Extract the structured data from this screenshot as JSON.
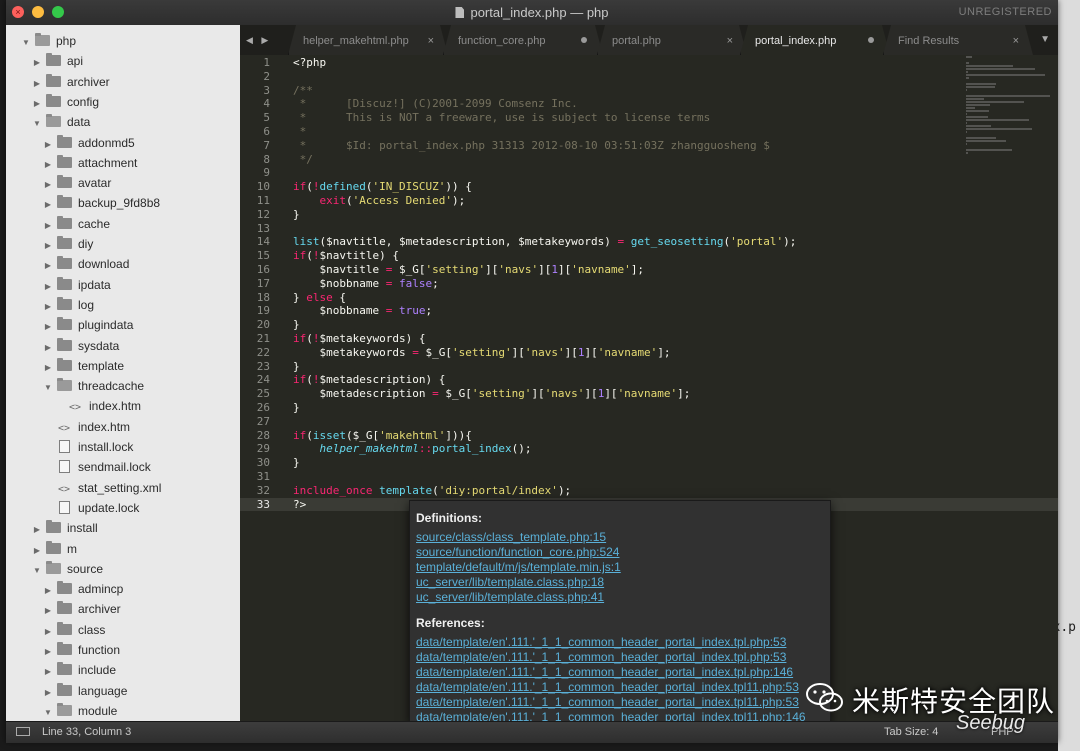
{
  "window": {
    "title": "portal_index.php — php",
    "unregistered": "UNREGISTERED"
  },
  "sidebar": {
    "items": [
      {
        "label": "php",
        "depth": 0,
        "type": "folder",
        "open": true
      },
      {
        "label": "api",
        "depth": 1,
        "type": "folder",
        "open": false
      },
      {
        "label": "archiver",
        "depth": 1,
        "type": "folder",
        "open": false
      },
      {
        "label": "config",
        "depth": 1,
        "type": "folder",
        "open": false
      },
      {
        "label": "data",
        "depth": 1,
        "type": "folder",
        "open": true
      },
      {
        "label": "addonmd5",
        "depth": 2,
        "type": "folder",
        "open": false
      },
      {
        "label": "attachment",
        "depth": 2,
        "type": "folder",
        "open": false
      },
      {
        "label": "avatar",
        "depth": 2,
        "type": "folder",
        "open": false
      },
      {
        "label": "backup_9fd8b8",
        "depth": 2,
        "type": "folder",
        "open": false
      },
      {
        "label": "cache",
        "depth": 2,
        "type": "folder",
        "open": false
      },
      {
        "label": "diy",
        "depth": 2,
        "type": "folder",
        "open": false
      },
      {
        "label": "download",
        "depth": 2,
        "type": "folder",
        "open": false
      },
      {
        "label": "ipdata",
        "depth": 2,
        "type": "folder",
        "open": false
      },
      {
        "label": "log",
        "depth": 2,
        "type": "folder",
        "open": false
      },
      {
        "label": "plugindata",
        "depth": 2,
        "type": "folder",
        "open": false
      },
      {
        "label": "sysdata",
        "depth": 2,
        "type": "folder",
        "open": false
      },
      {
        "label": "template",
        "depth": 2,
        "type": "folder",
        "open": false
      },
      {
        "label": "threadcache",
        "depth": 2,
        "type": "folder",
        "open": true
      },
      {
        "label": "index.htm",
        "depth": 3,
        "type": "code"
      },
      {
        "label": "index.htm",
        "depth": 2,
        "type": "code"
      },
      {
        "label": "install.lock",
        "depth": 2,
        "type": "file"
      },
      {
        "label": "sendmail.lock",
        "depth": 2,
        "type": "file"
      },
      {
        "label": "stat_setting.xml",
        "depth": 2,
        "type": "code"
      },
      {
        "label": "update.lock",
        "depth": 2,
        "type": "file"
      },
      {
        "label": "install",
        "depth": 1,
        "type": "folder",
        "open": false
      },
      {
        "label": "m",
        "depth": 1,
        "type": "folder",
        "open": false
      },
      {
        "label": "source",
        "depth": 1,
        "type": "folder",
        "open": true
      },
      {
        "label": "admincp",
        "depth": 2,
        "type": "folder",
        "open": false
      },
      {
        "label": "archiver",
        "depth": 2,
        "type": "folder",
        "open": false
      },
      {
        "label": "class",
        "depth": 2,
        "type": "folder",
        "open": false
      },
      {
        "label": "function",
        "depth": 2,
        "type": "folder",
        "open": false
      },
      {
        "label": "include",
        "depth": 2,
        "type": "folder",
        "open": false
      },
      {
        "label": "language",
        "depth": 2,
        "type": "folder",
        "open": false
      },
      {
        "label": "module",
        "depth": 2,
        "type": "folder",
        "open": true
      }
    ]
  },
  "tabs": [
    {
      "label": "helper_makehtml.php",
      "state": "close",
      "active": false
    },
    {
      "label": "function_core.php",
      "state": "dirty",
      "active": false
    },
    {
      "label": "portal.php",
      "state": "close",
      "active": false
    },
    {
      "label": "portal_index.php",
      "state": "dirty",
      "active": true
    },
    {
      "label": "Find Results",
      "state": "close",
      "active": false
    }
  ],
  "editor": {
    "current_line": 33,
    "lines": [
      [
        [
          "var",
          "<?php"
        ]
      ],
      [],
      [
        [
          "cm",
          "/**"
        ]
      ],
      [
        [
          "cm",
          " *      [Discuz!] (C)2001-2099 Comsenz Inc."
        ]
      ],
      [
        [
          "cm",
          " *      This is NOT a freeware, use is subject to license terms"
        ]
      ],
      [
        [
          "cm",
          " *"
        ]
      ],
      [
        [
          "cm",
          " *      $Id: portal_index.php 31313 2012-08-10 03:51:03Z zhangguosheng $"
        ]
      ],
      [
        [
          "cm",
          " */"
        ]
      ],
      [],
      [
        [
          "kw",
          "if"
        ],
        [
          "var",
          "("
        ],
        [
          "kw",
          "!"
        ],
        [
          "fn",
          "defined"
        ],
        [
          "var",
          "("
        ],
        [
          "str",
          "'IN_DISCUZ'"
        ],
        [
          "var",
          ")) {"
        ]
      ],
      [
        [
          "var",
          "    "
        ],
        [
          "kw",
          "exit"
        ],
        [
          "var",
          "("
        ],
        [
          "str",
          "'Access Denied'"
        ],
        [
          "var",
          ");"
        ]
      ],
      [
        [
          "var",
          "}"
        ]
      ],
      [],
      [
        [
          "fn",
          "list"
        ],
        [
          "var",
          "($navtitle, $metadescription, $metakeywords) "
        ],
        [
          "kw",
          "="
        ],
        [
          "var",
          " "
        ],
        [
          "fn",
          "get_seosetting"
        ],
        [
          "var",
          "("
        ],
        [
          "str",
          "'portal'"
        ],
        [
          "var",
          ");"
        ]
      ],
      [
        [
          "kw",
          "if"
        ],
        [
          "var",
          "("
        ],
        [
          "kw",
          "!"
        ],
        [
          "var",
          "$navtitle) {"
        ]
      ],
      [
        [
          "var",
          "    $navtitle "
        ],
        [
          "kw",
          "="
        ],
        [
          "var",
          " $_G["
        ],
        [
          "str",
          "'setting'"
        ],
        [
          "var",
          "]["
        ],
        [
          "str",
          "'navs'"
        ],
        [
          "var",
          "]["
        ],
        [
          "num",
          "1"
        ],
        [
          "var",
          "]["
        ],
        [
          "str",
          "'navname'"
        ],
        [
          "var",
          "];"
        ]
      ],
      [
        [
          "var",
          "    $nobbname "
        ],
        [
          "kw",
          "="
        ],
        [
          "var",
          " "
        ],
        [
          "num",
          "false"
        ],
        [
          "var",
          ";"
        ]
      ],
      [
        [
          "var",
          "} "
        ],
        [
          "kw",
          "else"
        ],
        [
          "var",
          " {"
        ]
      ],
      [
        [
          "var",
          "    $nobbname "
        ],
        [
          "kw",
          "="
        ],
        [
          "var",
          " "
        ],
        [
          "num",
          "true"
        ],
        [
          "var",
          ";"
        ]
      ],
      [
        [
          "var",
          "}"
        ]
      ],
      [
        [
          "kw",
          "if"
        ],
        [
          "var",
          "("
        ],
        [
          "kw",
          "!"
        ],
        [
          "var",
          "$metakeywords) {"
        ]
      ],
      [
        [
          "var",
          "    $metakeywords "
        ],
        [
          "kw",
          "="
        ],
        [
          "var",
          " $_G["
        ],
        [
          "str",
          "'setting'"
        ],
        [
          "var",
          "]["
        ],
        [
          "str",
          "'navs'"
        ],
        [
          "var",
          "]["
        ],
        [
          "num",
          "1"
        ],
        [
          "var",
          "]["
        ],
        [
          "str",
          "'navname'"
        ],
        [
          "var",
          "];"
        ]
      ],
      [
        [
          "var",
          "}"
        ]
      ],
      [
        [
          "kw",
          "if"
        ],
        [
          "var",
          "("
        ],
        [
          "kw",
          "!"
        ],
        [
          "var",
          "$metadescription) {"
        ]
      ],
      [
        [
          "var",
          "    $metadescription "
        ],
        [
          "kw",
          "="
        ],
        [
          "var",
          " $_G["
        ],
        [
          "str",
          "'setting'"
        ],
        [
          "var",
          "]["
        ],
        [
          "str",
          "'navs'"
        ],
        [
          "var",
          "]["
        ],
        [
          "num",
          "1"
        ],
        [
          "var",
          "]["
        ],
        [
          "str",
          "'navname'"
        ],
        [
          "var",
          "];"
        ]
      ],
      [
        [
          "var",
          "}"
        ]
      ],
      [],
      [
        [
          "kw",
          "if"
        ],
        [
          "var",
          "("
        ],
        [
          "fn",
          "isset"
        ],
        [
          "var",
          "($_G["
        ],
        [
          "str",
          "'makehtml'"
        ],
        [
          "var",
          "])){"
        ]
      ],
      [
        [
          "var",
          "    "
        ],
        [
          "it",
          "helper_makehtml"
        ],
        [
          "kw",
          "::"
        ],
        [
          "fn",
          "portal_index"
        ],
        [
          "var",
          "();"
        ]
      ],
      [
        [
          "var",
          "}"
        ]
      ],
      [],
      [
        [
          "kw",
          "include_once"
        ],
        [
          "var",
          " "
        ],
        [
          "fn",
          "template"
        ],
        [
          "var",
          "("
        ],
        [
          "str",
          "'diy:portal/index'"
        ],
        [
          "var",
          ");"
        ]
      ],
      [
        [
          "var",
          "?>"
        ]
      ]
    ]
  },
  "popup": {
    "definitions_title": "Definitions:",
    "definitions": [
      "source/class/class_template.php:15",
      "source/function/function_core.php:524",
      "template/default/m/js/template.min.js:1",
      "uc_server/lib/template.class.php:18",
      "uc_server/lib/template.class.php:41"
    ],
    "references_title": "References:",
    "references": [
      "data/template/en'.111.'_1_1_common_header_portal_index.tpl.php:53",
      "data/template/en'.111.'_1_1_common_header_portal_index.tpl.php:53",
      "data/template/en'.111.'_1_1_common_header_portal_index.tpl.php:146",
      "data/template/en'.111.'_1_1_common_header_portal_index.tpl11.php:53",
      "data/template/en'.111.'_1_1_common_header_portal_index.tpl11.php:53",
      "data/template/en'.111.'_1_1_common_header_portal_index.tpl11.php:146"
    ]
  },
  "statusbar": {
    "position": "Line 33, Column 3",
    "tab_size": "Tab Size: 4",
    "syntax": "PHP"
  },
  "watermark": {
    "text": "米斯特安全团队",
    "sub": "Seebug",
    "icon": "wechat-icon"
  },
  "colors": {
    "keyword": "#f92672",
    "function": "#66d9ef",
    "string": "#e6db74",
    "comment": "#75715e",
    "number": "#ae81ff",
    "link": "#5ab0d8"
  }
}
